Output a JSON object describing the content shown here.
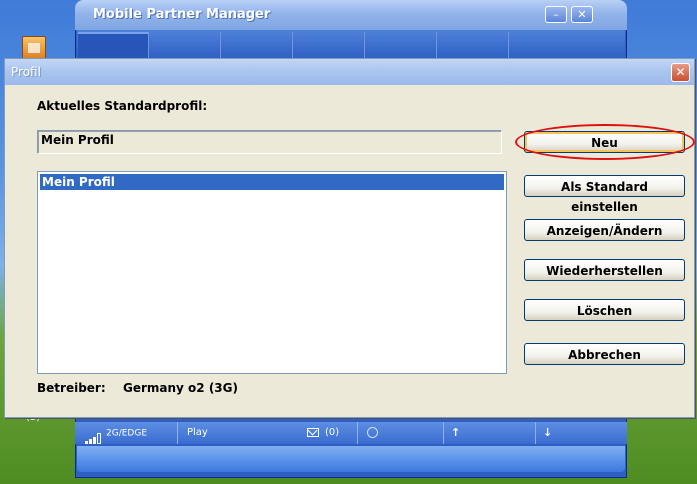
{
  "background_window": {
    "title": "Mobile Partner Manager",
    "minimize_symbol": "–",
    "close_symbol": "✕",
    "status_bar": {
      "network": "2G/EDGE",
      "player": "Play",
      "sms_count": "(0)"
    }
  },
  "dialog": {
    "title": "Profil",
    "close_symbol": "✕",
    "current_profile_label": "Aktuelles Standardprofil:",
    "current_profile_value": "Mein Profil",
    "profiles": [
      "Mein Profil"
    ],
    "selected_profile": "Mein Profil",
    "operator_label": "Betreiber:",
    "operator_value": "Germany o2 (3G)",
    "buttons": {
      "new": "Neu",
      "set_default": "Als Standard einstellen",
      "view_edit": "Anzeigen/Ändern",
      "restore": "Wiederherstellen",
      "delete": "Löschen",
      "cancel": "Abbrechen"
    }
  },
  "annotation": {
    "highlight_color": "#e01010",
    "highlighted": "Neu"
  },
  "colors": {
    "selection": "#316ac5",
    "dialog_bg": "#ece9d8"
  }
}
